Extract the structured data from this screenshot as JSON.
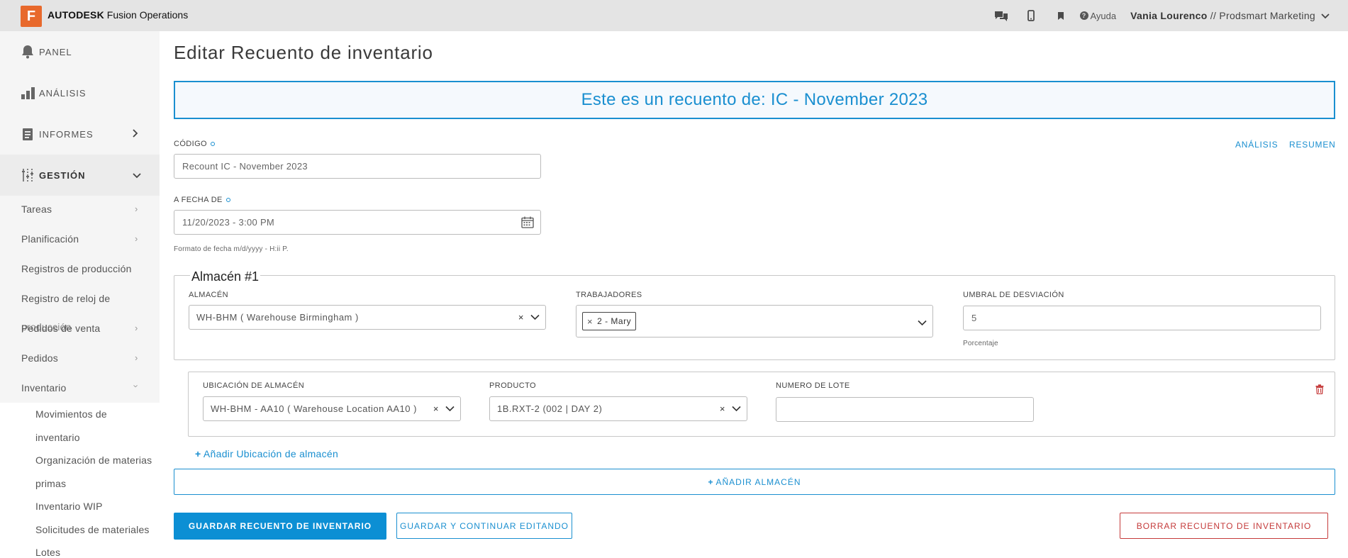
{
  "app": {
    "logo_letter": "F",
    "brand": "AUTODESK",
    "product": "Fusion Operations",
    "help": "Ayuda",
    "user_name": "Vania Lourenco",
    "user_company": "// Prodsmart Marketing"
  },
  "sidebar": {
    "main": [
      {
        "label": "PANEL",
        "icon": "bell-icon"
      },
      {
        "label": "ANÁLISIS",
        "icon": "bar-chart-icon"
      },
      {
        "label": "INFORMES",
        "icon": "report-icon"
      },
      {
        "label": "GESTIÓN",
        "icon": "sliders-icon"
      }
    ],
    "sub": [
      "Tareas",
      "Planificación",
      "Registros de producción",
      "Registro de reloj de",
      "Pedidos de venta",
      "Pedidos",
      "Inventario"
    ],
    "overlap_text": "producción",
    "inventory_items": [
      "Movimientos de",
      "inventario",
      "Organización de materias",
      "primas",
      "Inventario WIP",
      "Solicitudes de materiales",
      "Lotes"
    ]
  },
  "page": {
    "title": "Editar Recuento de inventario",
    "banner": "Este es un recuento de: IC - November 2023",
    "code_label": "CÓDIGO",
    "code_value": "Recount IC - November 2023",
    "link_analysis": "ANÁLISIS",
    "link_summary": "RESUMEN",
    "date_label": "A FECHA DE",
    "date_value": "11/20/2023 - 3:00 PM",
    "date_help": "Formato de fecha m/d/yyyy - H:ii P."
  },
  "warehouse": {
    "legend": "Almacén #1",
    "warehouse_label": "ALMACÉN",
    "warehouse_value": "WH-BHM ( Warehouse Birmingham )",
    "workers_label": "TRABAJADORES",
    "worker_tag": "2 - Mary",
    "threshold_label": "UMBRAL DE DESVIACIÓN",
    "threshold_value": "5",
    "threshold_help": "Porcentaje"
  },
  "location": {
    "location_label": "UBICACIÓN DE ALMACÉN",
    "location_value": "WH-BHM - AA10 ( Warehouse Location AA10 )",
    "product_label": "PRODUCTO",
    "product_value": "1B.RXT-2 (002 | DAY 2)",
    "lot_label": "NUMERO DE LOTE",
    "lot_value": ""
  },
  "actions": {
    "add_location": "Añadir Ubicación de almacén",
    "add_warehouse": "AÑADIR ALMACÉN",
    "save": "GUARDAR RECUENTO DE INVENTARIO",
    "save_continue": "GUARDAR Y CONTINUAR EDITANDO",
    "delete": "BORRAR RECUENTO DE INVENTARIO"
  },
  "colors": {
    "accent": "#1a8fd0",
    "primary_button": "#0c8fd4",
    "danger": "#c53b3b",
    "logo": "#e8692c",
    "topbar": "#e4e4e4"
  }
}
